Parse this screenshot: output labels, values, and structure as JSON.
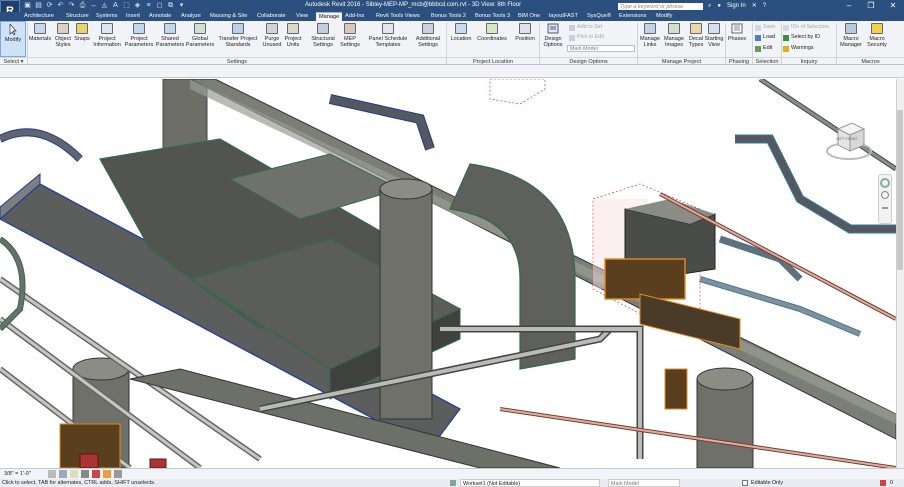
{
  "titlebar": {
    "app_letter": "R",
    "title": "Autodesk Revit 2016 -    Sibley-MEP-MP_mcb@bbbcd.com.rvt - 3D View: 8th Floor",
    "search_placeholder": "Type a keyword or phrase",
    "sign_in": "Sign In",
    "qat_icons": [
      "open-icon",
      "save-icon",
      "sync-icon",
      "undo-icon",
      "redo-icon",
      "print-icon",
      "measure-icon",
      "tag-icon",
      "text-icon",
      "3d-view-icon",
      "section-icon",
      "thin-lines-icon",
      "close-hidden-icon",
      "switch-windows-icon",
      "dropdown-icon"
    ]
  },
  "tabs": [
    "Architecture",
    "Structure",
    "Systems",
    "Insert",
    "Annotate",
    "Analyze",
    "Massing & Site",
    "Collaborate",
    "View",
    "Manage",
    "Add-Ins",
    "Revit Tools Views",
    "Bonus Tools 2",
    "Bonus Tools 3",
    "BIM One",
    "layoutFAST",
    "SysQue®",
    "Extensions",
    "Modify"
  ],
  "active_tab": "Manage",
  "ribbon": {
    "modify": "Modify",
    "settings_buttons": [
      {
        "label": "Materials",
        "icon": "materials-icon"
      },
      {
        "label": "Object Styles",
        "icon": "object-styles-icon"
      },
      {
        "label": "Snaps",
        "icon": "snaps-icon"
      },
      {
        "label": "Project Information",
        "icon": "project-info-icon"
      },
      {
        "label": "Project Parameters",
        "icon": "project-parameters-icon"
      },
      {
        "label": "Shared Parameters",
        "icon": "shared-parameters-icon"
      },
      {
        "label": "Global Parameters",
        "icon": "global-parameters-icon"
      },
      {
        "label": "Transfer Project Standards",
        "icon": "transfer-standards-icon"
      },
      {
        "label": "Purge Unused",
        "icon": "purge-icon"
      },
      {
        "label": "Project Units",
        "icon": "units-icon"
      },
      {
        "label": "Structural Settings",
        "icon": "structural-settings-icon"
      },
      {
        "label": "MEP Settings",
        "icon": "mep-settings-icon"
      },
      {
        "label": "Panel Schedule Templates",
        "icon": "panel-schedule-icon"
      },
      {
        "label": "Additional Settings",
        "icon": "additional-settings-icon"
      }
    ],
    "location_buttons": [
      {
        "label": "Location",
        "icon": "location-icon"
      },
      {
        "label": "Coordinates",
        "icon": "coordinates-icon"
      },
      {
        "label": "Position",
        "icon": "position-icon"
      }
    ],
    "design_options": {
      "button": "Design Options",
      "add_to_set": "Add to Set",
      "pick_to_edit": "Pick to Edit",
      "main_model": "Main Model"
    },
    "manage_project_buttons": [
      {
        "label": "Manage Links",
        "icon": "manage-links-icon"
      },
      {
        "label": "Manage Images",
        "icon": "manage-images-icon"
      },
      {
        "label": "Decal Types",
        "icon": "decal-types-icon"
      },
      {
        "label": "Starting View",
        "icon": "starting-view-icon"
      }
    ],
    "phases": "Phases",
    "selection": {
      "save": "Save",
      "load": "Load",
      "edit": "Edit"
    },
    "inquiry": {
      "ids": "IDs of Selection",
      "select_by_id": "Select by ID",
      "warnings": "Warnings"
    },
    "macros": [
      {
        "label": "Macro Manager",
        "icon": "macro-manager-icon"
      },
      {
        "label": "Macro Security",
        "icon": "macro-security-icon"
      }
    ],
    "panels": {
      "select": "Select",
      "settings": "Settings",
      "project_location": "Project Location",
      "design_options": "Design Options",
      "manage_project": "Manage Project",
      "phasing": "Phasing",
      "selection": "Selection",
      "inquiry": "Inquiry",
      "macros": "Macros"
    }
  },
  "viewcube": {
    "faces": "LEFT FRONT"
  },
  "view_control": {
    "scale": "3/8\" = 1'-0\""
  },
  "status": {
    "prompt": "Click to select, TAB for alternates, CTRL adds, SHIFT unselects.",
    "workset": "Workset1 (Not Editable)",
    "model": "Main Model",
    "editable_only": "Editable Only",
    "filter_count": "0"
  }
}
